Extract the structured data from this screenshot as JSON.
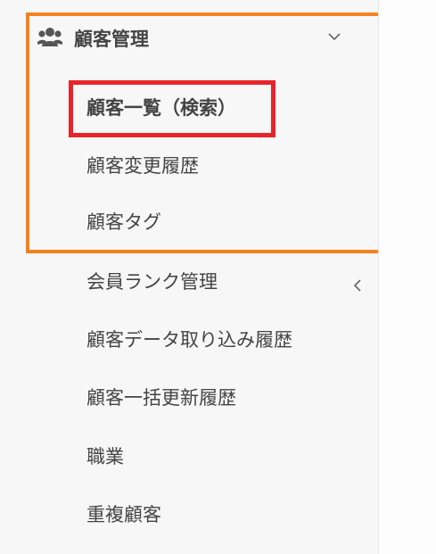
{
  "sidebar": {
    "group": {
      "label": "顧客管理",
      "icon": "users-icon",
      "expand_icon": "chevron-down-icon"
    },
    "sub_items": [
      {
        "label": "顧客一覧（検索）",
        "active": true
      },
      {
        "label": "顧客変更履歴",
        "active": false
      },
      {
        "label": "顧客タグ",
        "active": false
      }
    ],
    "items": [
      {
        "label": "会員ランク管理",
        "has_submenu": true,
        "submenu_icon": "chevron-left-icon"
      },
      {
        "label": "顧客データ取り込み履歴"
      },
      {
        "label": "顧客一括更新履歴"
      },
      {
        "label": "職業"
      },
      {
        "label": "重複顧客"
      }
    ]
  },
  "highlights": {
    "group_frame_color": "#f5821f",
    "active_item_frame_color": "#e8232a"
  }
}
